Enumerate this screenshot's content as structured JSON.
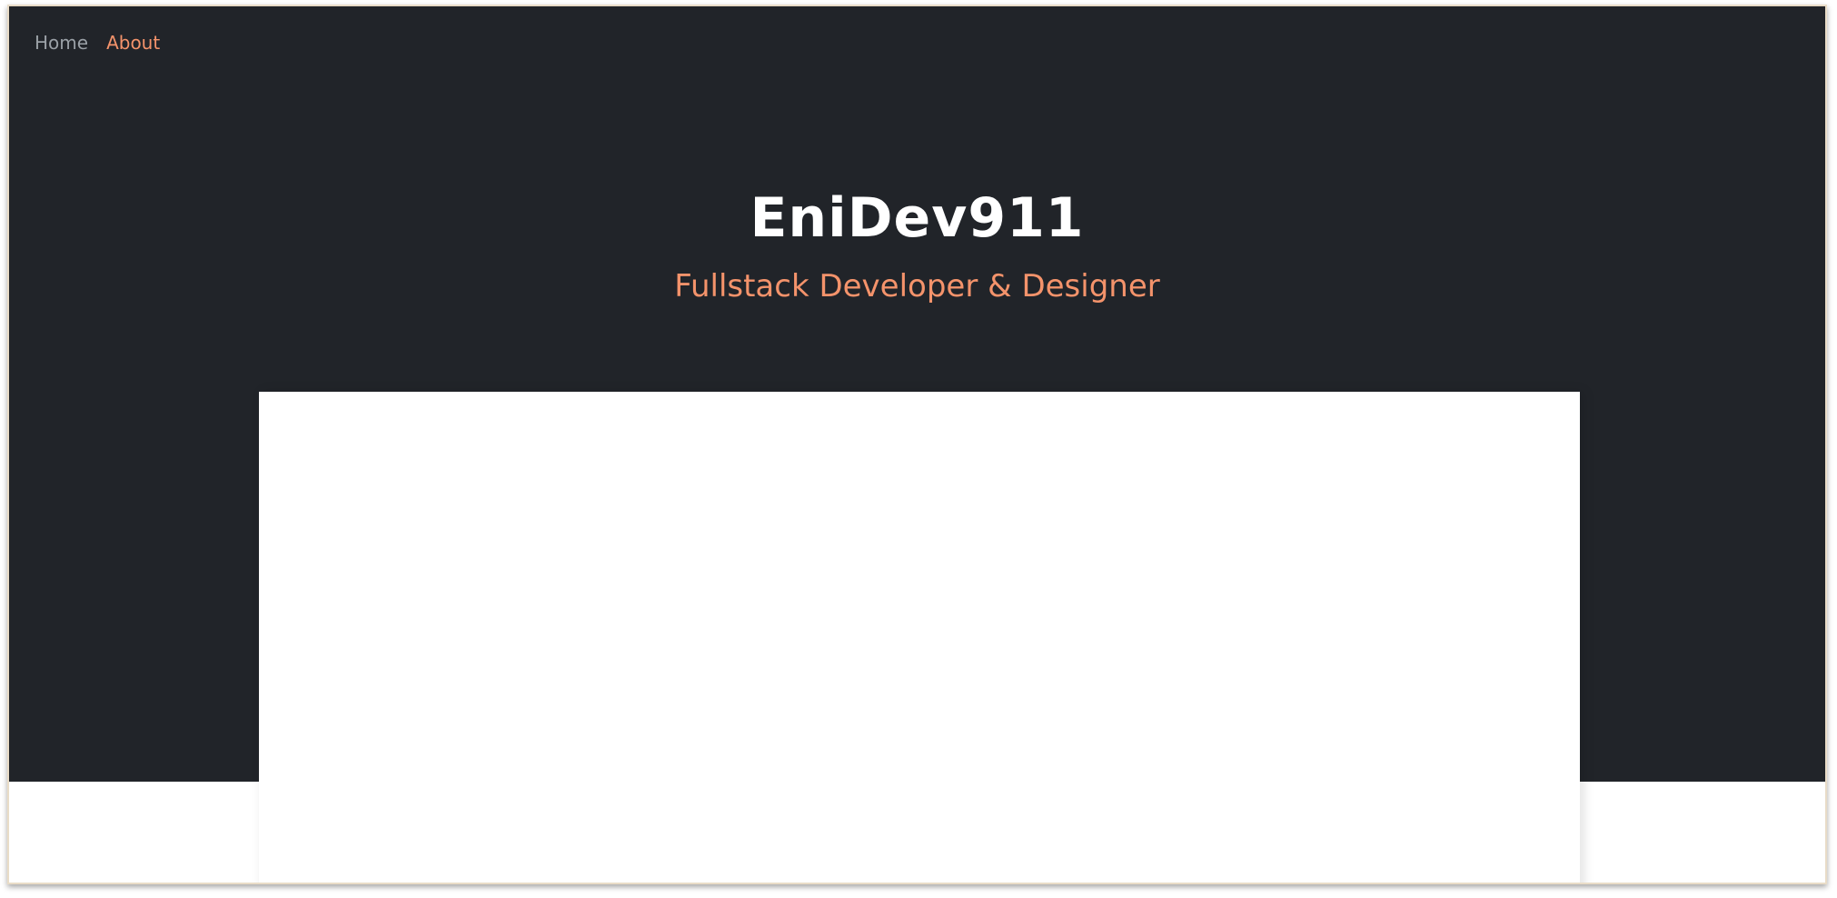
{
  "nav": {
    "items": [
      {
        "label": "Home",
        "active": false
      },
      {
        "label": "About",
        "active": true
      }
    ]
  },
  "hero": {
    "title": "EniDev911",
    "subtitle": "Fullstack Developer & Designer"
  },
  "colors": {
    "background_dark": "#212429",
    "accent": "#f4936b",
    "nav_inactive": "#9aa0a6",
    "title_text": "#ffffff",
    "content_panel": "#ffffff"
  }
}
